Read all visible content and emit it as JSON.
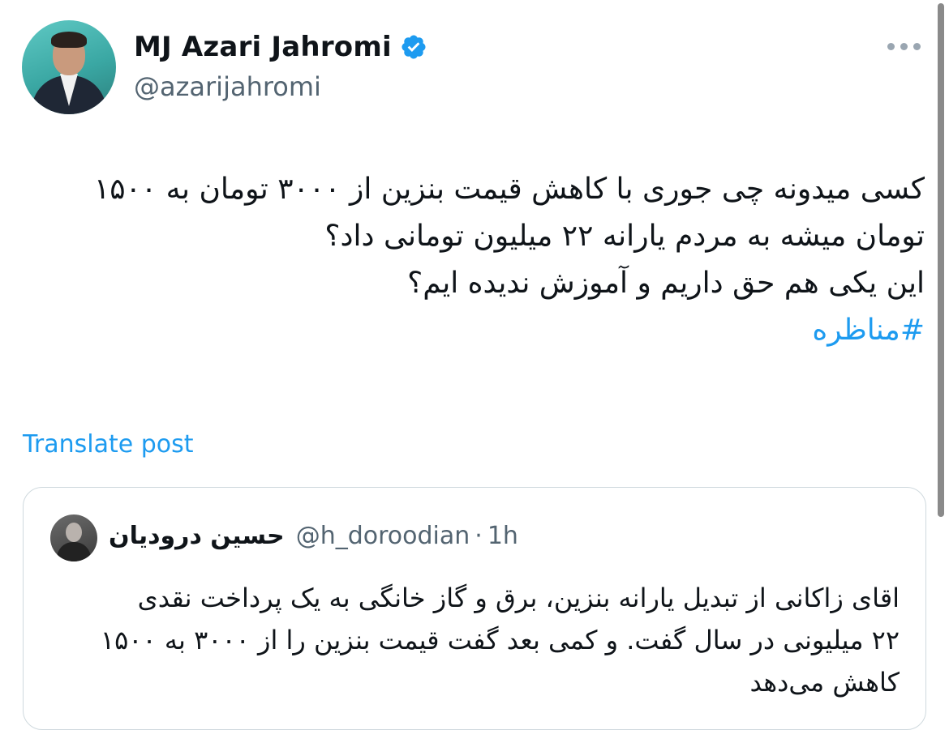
{
  "author": {
    "name": "MJ Azari Jahromi",
    "handle": "@azarijahromi",
    "verified": true,
    "verified_color": "#1d9bf0"
  },
  "tweet": {
    "lines": [
      "کسی میدونه چی جوری با کاهش قیمت بنزین از ۳۰۰۰ تومان به ۱۵۰۰",
      "تومان میشه به مردم یارانه ۲۲ میلیون تومانی داد؟",
      "این یکی هم حق داریم و آموزش ندیده ایم؟"
    ],
    "hashtag": "#مناظره"
  },
  "translate_label": "Translate post",
  "quote": {
    "name": "حسین درودیان",
    "handle": "@h_doroodian",
    "separator": "·",
    "time": "1h",
    "lines": [
      "اقای زاکانی از تبدیل یارانه بنزین، برق و گاز خانگی به یک پرداخت نقدی",
      "۲۲ میلیونی در سال گفت. و کمی بعد گفت قیمت بنزین را از ۳۰۰۰ به ۱۵۰۰",
      "کاهش می‌دهد"
    ]
  },
  "icons": {
    "verified": "verified-badge-icon",
    "more": "more-options-icon"
  },
  "colors": {
    "accent": "#1d9bf0",
    "secondary_text": "#536471",
    "border": "#cfd9de"
  }
}
